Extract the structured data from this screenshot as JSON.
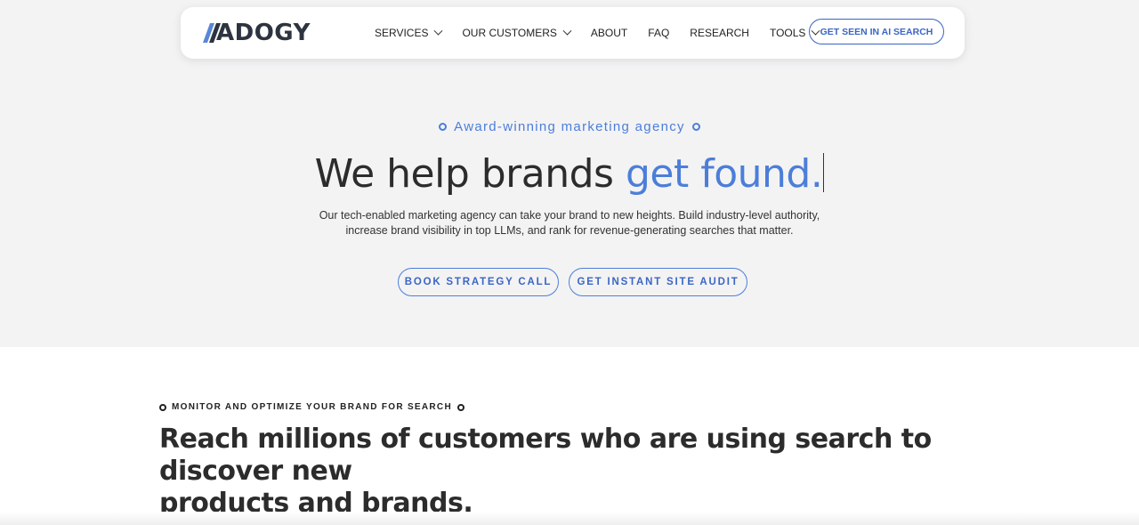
{
  "brand": {
    "logo_text": "ADOGY",
    "logo_mark_icon": "slash-mark-icon"
  },
  "nav": {
    "items": [
      {
        "label": "SERVICES",
        "has_dropdown": true
      },
      {
        "label": "OUR CUSTOMERS",
        "has_dropdown": true
      },
      {
        "label": "ABOUT",
        "has_dropdown": false
      },
      {
        "label": "FAQ",
        "has_dropdown": false
      },
      {
        "label": "RESEARCH",
        "has_dropdown": false
      },
      {
        "label": "TOOLS",
        "has_dropdown": true
      }
    ],
    "cta_label": "GET SEEN IN AI SEARCH"
  },
  "hero": {
    "eyebrow": "Award-winning marketing agency",
    "headline_plain": "We help brands ",
    "headline_accent": "get found.",
    "subtext_line1": "Our tech-enabled marketing agency can take your brand to new heights. Build industry-level authority,",
    "subtext_line2": "increase brand visibility in top LLMs, and rank for revenue-generating searches that matter.",
    "primary_button": "BOOK STRATEGY CALL",
    "secondary_button": "GET INSTANT SITE AUDIT"
  },
  "section": {
    "eyebrow": "MONITOR AND OPTIMIZE YOUR BRAND FOR SEARCH",
    "title_line1": "Reach millions of customers who are using search to discover new",
    "title_line2": "products and brands."
  },
  "colors": {
    "accent": "#4c7ed9",
    "hero_bg": "#f3f3f4",
    "text_dark": "#2c2c2c"
  }
}
